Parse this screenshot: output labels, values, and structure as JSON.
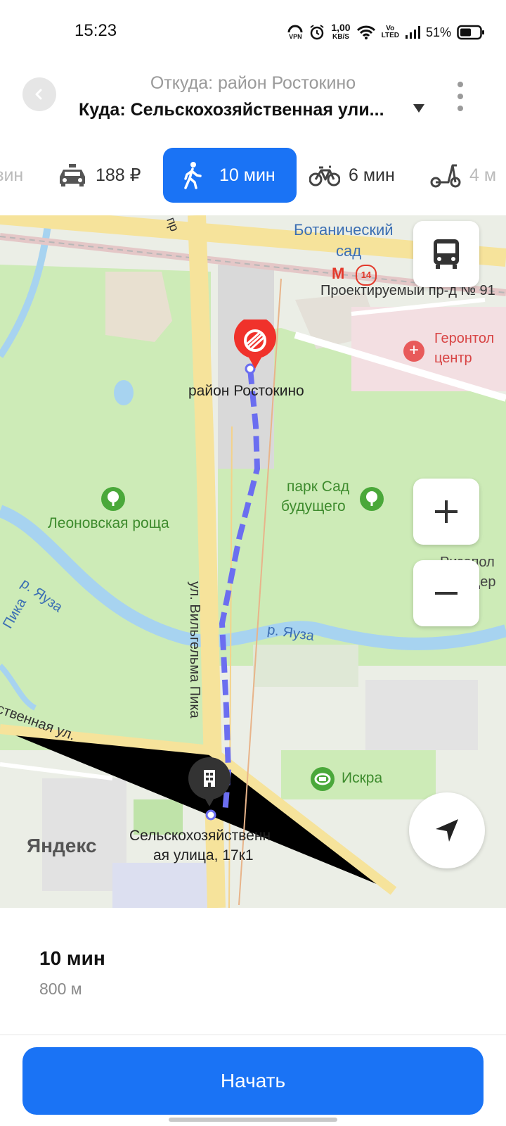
{
  "status_bar": {
    "time": "15:23",
    "vpn": "VPN",
    "speed_value": "1,00",
    "speed_unit": "KB/S",
    "volte_1": "Vo",
    "volte_2": "LTED",
    "battery": "51%",
    "icons": [
      "vpn-icon",
      "alarm-icon",
      "wifi-icon",
      "signal-icon",
      "battery-icon"
    ]
  },
  "header": {
    "from": "Откуда: район Ростокино",
    "to": "Куда: Сельскохозяйственная ули...",
    "icons": [
      "back-icon",
      "caret-down-icon",
      "more-icon"
    ]
  },
  "transport_tabs": [
    {
      "id": "transit",
      "label": "зин",
      "icon": "transit-icon"
    },
    {
      "id": "taxi",
      "label": "188 ₽",
      "icon": "taxi-icon"
    },
    {
      "id": "walk",
      "label": "10 мин",
      "icon": "walk-icon",
      "selected": true
    },
    {
      "id": "bike",
      "label": "6 мин",
      "icon": "bike-icon"
    },
    {
      "id": "scooter",
      "label": "4 м",
      "icon": "scooter-icon"
    }
  ],
  "map": {
    "labels": {
      "botanical_1": "Ботанический",
      "botanical_2": "сад",
      "metro_line": "14",
      "proezd": "Проектируемый пр-д № 91",
      "geront_1": "Геронтол",
      "geront_2": "центр",
      "rostokino": "район Ростокино",
      "park_1": "парк Сад",
      "park_2": "будущего",
      "leonov": "Леоновская роща",
      "rizopol_1": "Ризопол",
      "rizopol_2": "цер",
      "yauza_left": "р. Яуза",
      "yauza_right": "р. Яуза",
      "pika": "ул. Вильгельма Пика",
      "pika_left": "Пика",
      "selsk_street": "ственная ул.",
      "iskra": "Искра",
      "dest_1": "Сельскохозяйственн",
      "dest_2": "ая улица, 17к1",
      "yandex": "Яндекс",
      "top_road": "пр"
    },
    "colors": {
      "park": "#cdebb7",
      "road": "#f6e39b",
      "water": "#a7d3f0",
      "route": "#6b6ef0",
      "pin": "#f0322b",
      "accent": "#1a73f5"
    },
    "icons": [
      "bus-icon",
      "zoom-in-icon",
      "zoom-out-icon",
      "locate-icon",
      "start-pin-icon",
      "building-pin-icon",
      "park-icon",
      "stadium-icon",
      "hospital-icon",
      "metro-icon"
    ]
  },
  "route": {
    "time": "10 мин",
    "distance": "800 м"
  },
  "start_button": "Начать"
}
